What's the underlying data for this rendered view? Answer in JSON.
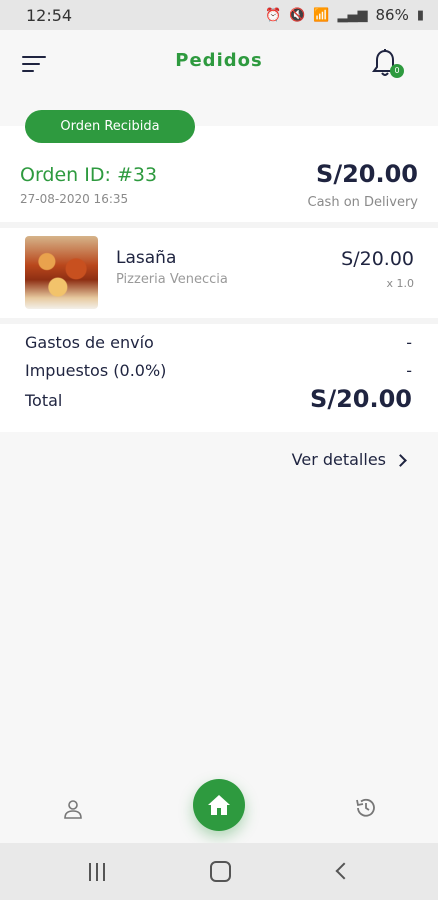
{
  "status_bar": {
    "time": "12:54",
    "battery": "86%",
    "icons": [
      "alarm-icon",
      "mute-icon",
      "wifi-icon",
      "signal-icon",
      "battery-icon"
    ]
  },
  "header": {
    "title": "Pedidos",
    "notification_count": "0"
  },
  "order": {
    "status": "Orden Recibida",
    "id_label": "Orden ID: #33",
    "date": "27-08-2020 16:35",
    "total": "S/20.00",
    "payment": "Cash on Delivery",
    "items": [
      {
        "name": "Lasaña",
        "shop": "Pizzeria Veneccia",
        "price": "S/20.00",
        "qty": "x 1.0"
      }
    ],
    "summary": {
      "shipping_label": "Gastos de envío",
      "shipping_value": "-",
      "tax_label": "Impuestos (0.0%)",
      "tax_value": "-",
      "total_label": "Total",
      "total_value": "S/20.00"
    },
    "details_link": "Ver detalles"
  },
  "colors": {
    "accent": "#2e9a3f",
    "text": "#1f2440",
    "muted": "#8a8a8a"
  }
}
